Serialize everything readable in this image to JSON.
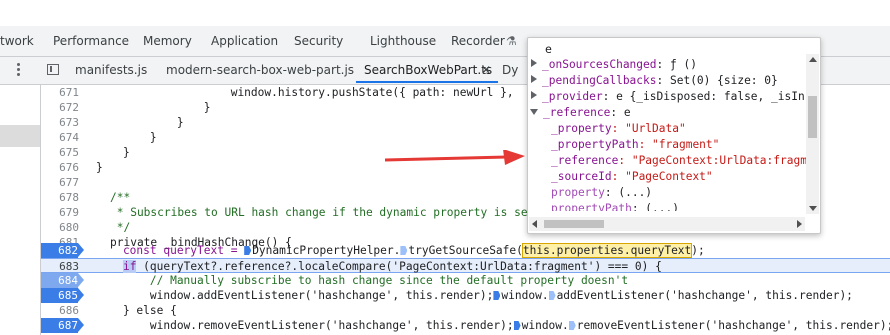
{
  "panel_tabs": [
    "twork",
    "Performance",
    "Memory",
    "Application",
    "Security",
    "Lighthouse",
    "Recorder"
  ],
  "file_tabs": [
    "manifests.js",
    "modern-search-box-web-part.js",
    "SearchBoxWebPart.ts",
    "Dy"
  ],
  "active_file": "SearchBoxWebPart.ts",
  "colors": {
    "accent": "#1a73e8",
    "breakpoint": "#3a7de6",
    "arrow": "#e53935"
  },
  "code_lines": [
    {
      "n": "671",
      "text": "                    window.history.pushState({ path: newUrl },"
    },
    {
      "n": "672",
      "text": "                }"
    },
    {
      "n": "673",
      "text": "            }"
    },
    {
      "n": "674",
      "text": "        }"
    },
    {
      "n": "675",
      "text": "    }"
    },
    {
      "n": "676",
      "text": "}"
    },
    {
      "n": "677",
      "text": ""
    },
    {
      "n": "678",
      "text": "/**"
    },
    {
      "n": "679",
      "text": " * Subscribes to URL hash change if the dynamic property is set"
    },
    {
      "n": "680",
      "text": " */"
    },
    {
      "n": "681",
      "text": "private _bindHashChange() {"
    },
    {
      "n": "682",
      "p1": "    const queryText = ",
      "p2": "DynamicPropertyHelper.",
      "p3": "tryGetSourceSafe(",
      "hl": "this.properties.queryText",
      "p4": ");"
    },
    {
      "n": "683",
      "kw": "if",
      "rest": " (queryText?.reference?.localeCompare('PageContext:UrlData:fragment') === 0) {"
    },
    {
      "n": "684",
      "text": "        // Manually subscribe to hash change since the default property doesn't"
    },
    {
      "n": "685",
      "a": "        window.addEventListener('hashchange', this.render);",
      "b": "window.",
      "c": "addEventListener('hashchange', this.render);"
    },
    {
      "n": "686",
      "text": "    } else {"
    },
    {
      "n": "687",
      "a": "        window.removeEventListener('hashchange', this.render);",
      "b": "window.",
      "c": "removeEventListener('hashchange', this.render);"
    }
  ],
  "popover": {
    "header": "e",
    "rows": [
      {
        "expand": "right",
        "key": "_onSourcesChanged",
        "val": ": ƒ ()"
      },
      {
        "expand": "right",
        "key": "_pendingCallbacks",
        "val": ": Set(0) {size: 0}"
      },
      {
        "expand": "right",
        "key": "_provider",
        "val": ": e {_isDisposed: false, _isIn"
      },
      {
        "expand": "down",
        "key": "_reference",
        "val": ": e"
      },
      {
        "expand": "none",
        "key": "_property",
        "val": ": \"UrlData\""
      },
      {
        "expand": "none",
        "key": "_propertyPath",
        "val": ": \"fragment\""
      },
      {
        "expand": "none",
        "key": "_reference",
        "val": ": \"PageContext:UrlData:fragm"
      },
      {
        "expand": "none",
        "key": "_sourceId",
        "val": ": \"PageContext\""
      },
      {
        "expand": "none",
        "key": "property",
        "val": ": (...)"
      },
      {
        "expand": "none",
        "key": "propertyPath",
        "val": ": (...)"
      }
    ]
  }
}
